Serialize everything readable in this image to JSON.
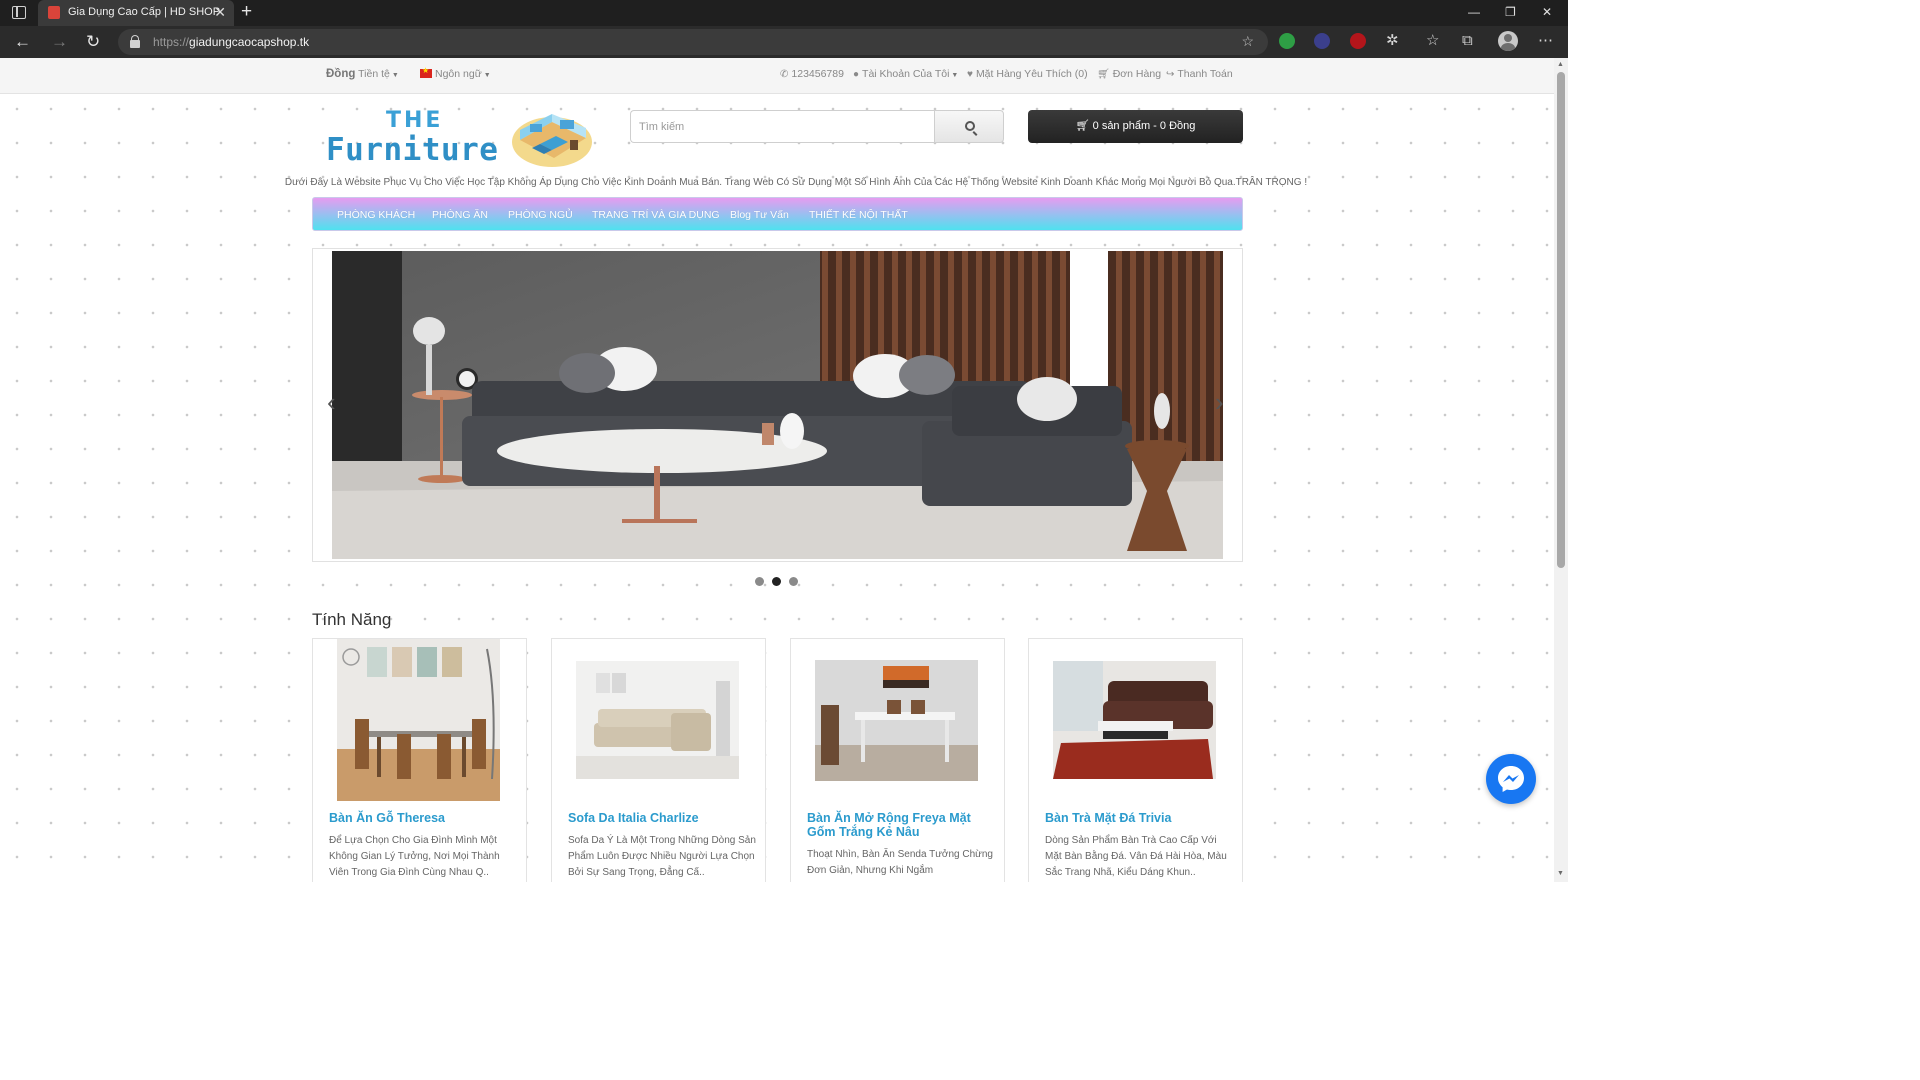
{
  "browser": {
    "tab_title": "Gia Dụng Cao Cấp | HD SHOP",
    "url_prefix": "https://",
    "url_domain": "giadungcaocapshop.tk"
  },
  "topbar": {
    "currency_symbol": "Đồng",
    "currency_label": "Tiền tệ",
    "language_label": "Ngôn ngữ",
    "phone": "123456789",
    "account": "Tài Khoản Của Tôi",
    "wishlist": "Mặt Hàng Yêu Thích (0)",
    "orders": "Đơn Hàng",
    "checkout": "Thanh Toán"
  },
  "header": {
    "logo_line1": "THE",
    "logo_line2": "Furniture",
    "search_placeholder": "Tìm kiếm",
    "cart_label": "0 sản phẩm - 0 Đồng"
  },
  "notice": "Dưới Đây Là Website Phục Vụ Cho Việc Học Tập Không Áp Dụng Cho Việc Kinh Doanh Mua Bán. Trang Web Có Sử Dụng Một Số Hình Ảnh Của Các Hệ Thống Website Kinh Doanh Khác Mong Mọi Người Bỏ Qua.TRÂN TRỌNG !",
  "menu": {
    "items": [
      {
        "label": "PHÒNG KHÁCH"
      },
      {
        "label": "PHÒNG ĂN"
      },
      {
        "label": "PHÒNG NGỦ"
      },
      {
        "label": "TRANG TRÍ VÀ GIA DỤNG"
      },
      {
        "label": "Blog Tư Vấn"
      },
      {
        "label": "THIẾT KẾ NỘI THẤT"
      }
    ]
  },
  "slider": {
    "slide_count": 3,
    "active_index": 1
  },
  "featured": {
    "title": "Tính Năng",
    "products": [
      {
        "name": "Bàn Ăn Gỗ Theresa",
        "desc": "Để Lựa Chọn Cho Gia Đình Mình Một Không Gian Lý Tưởng, Nơi Mọi Thành Viên Trong Gia Đình Cùng Nhau Q.."
      },
      {
        "name": "Sofa Da Italia Charlize",
        "desc": "Sofa Da Ý Là Một Trong Những Dòng Sản Phẩm Luôn Được Nhiều Người Lựa Chọn Bởi Sự Sang Trọng, Đẳng Cấ.."
      },
      {
        "name": "Bàn Ăn Mở Rộng Freya Mặt Gốm Trắng Kẻ Nâu",
        "desc": "Thoạt Nhìn, Bàn Ăn Senda Tưởng Chừng Đơn Giản, Nhưng Khi Ngắm"
      },
      {
        "name": "Bàn Trà Mặt Đá Trivia",
        "desc": "Dòng Sản Phẩm Bàn Trà Cao Cấp Với Mặt Bàn Bằng Đá. Vân Đá Hài Hòa, Màu Sắc Trang Nhã, Kiểu Dáng Khun.."
      }
    ]
  },
  "colors": {
    "accent_link": "#2b9bcd",
    "menu_gradient_top": "#e69cf0",
    "menu_gradient_bottom": "#4fe1ef",
    "cart_button": "#2b2b2b",
    "messenger": "#1877f2"
  },
  "icons": [
    "phone-icon",
    "user-icon",
    "heart-icon",
    "cart-icon",
    "share-icon",
    "search-icon",
    "messenger-icon"
  ]
}
